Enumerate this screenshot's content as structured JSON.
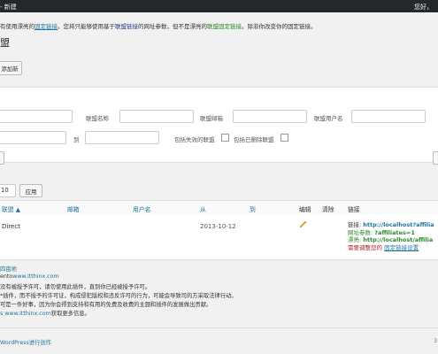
{
  "adminbar": {
    "left": "- 新建",
    "right": "您好，"
  },
  "notice": {
    "p1": "有使用漂亮的",
    "link1": "固定链接",
    "p2": "。您将只能够使用基于",
    "link2": "联盟链接",
    "p3": "的网址参数，但不是漂亮的",
    "link3": "联盟固定链接",
    "p4": "。除非你改变你的固定链接。"
  },
  "page": {
    "title": "盟",
    "add_button": "添加新"
  },
  "filters": {
    "name_label": "联盟名称",
    "email_label": "联盟邮箱",
    "username_label": "联盟用户名",
    "to_label": "到",
    "include_inactive": "包括失效的联盟",
    "include_deleted": "包括已删除联盟"
  },
  "pagination": {
    "per_page": "10",
    "apply": "应用"
  },
  "table": {
    "headers": {
      "affiliate": "联盟 ▲",
      "email": "邮箱",
      "username": "用户名",
      "from": "从",
      "to": "到",
      "edit": "编辑",
      "clear": "清除",
      "link": "链接"
    },
    "row": {
      "name": "Direct",
      "date": "2013-10-12",
      "link_label": "链接:",
      "link_value": "http://localhost?affilia",
      "param_label": "网址参数:",
      "param_value": "?affiliates=1",
      "pretty_label": "漂亮:",
      "pretty_value": "http://localhost/affilia",
      "warning": "需要调整您的",
      "warning_link": "固定链接设置"
    }
  },
  "credits": {
    "line1": "四亩地",
    "line2_prefix": "ento",
    "line2_link": "www.itthinx.com",
    "line3": "没有被授予许可，请勿使用此插件，直到你已经被授予许可。",
    "line4": "*插件，而不授予的许可证，构成侵犯版权和违反许可的行为，可能会导致司的方采取法律行动。",
    "line5": "可是一件好事，因为你会得到支持和有用的免费及收费的主题和插件的发展做出贡献。",
    "line6_link": "s www.itthinx.com",
    "line6_suffix": "获取更多信息。"
  },
  "footer": {
    "text": "WordPress进行创作",
    "version": "3"
  }
}
